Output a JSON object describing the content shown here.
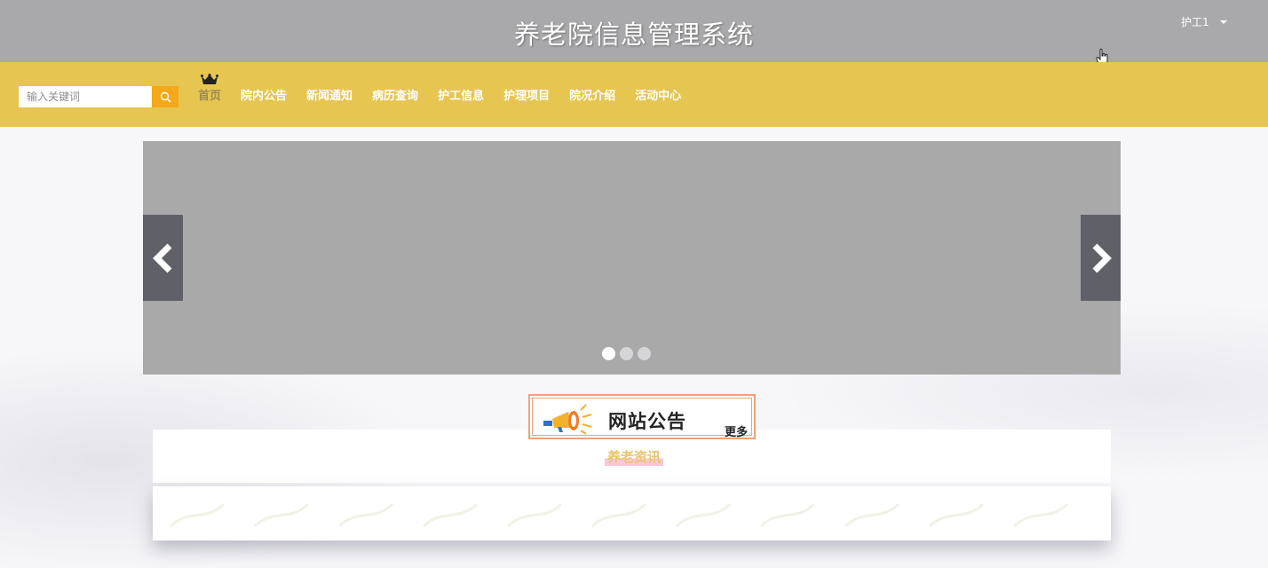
{
  "header": {
    "site_title": "养老院信息管理系统",
    "user_name": "护工1"
  },
  "search": {
    "placeholder": "输入关键词",
    "icon": "search-icon"
  },
  "nav": {
    "items": [
      {
        "label": "首页",
        "active": true
      },
      {
        "label": "院内公告"
      },
      {
        "label": "新闻通知"
      },
      {
        "label": "病历查询"
      },
      {
        "label": "护工信息"
      },
      {
        "label": "护理项目"
      },
      {
        "label": "院况介绍"
      },
      {
        "label": "活动中心"
      }
    ]
  },
  "banner": {
    "dots": 3,
    "active_dot": 1,
    "prev_icon": "chevron-left-icon",
    "next_icon": "chevron-right-icon"
  },
  "notice": {
    "title": "网站公告",
    "more_label": "更多",
    "icon": "megaphone-icon"
  },
  "news": {
    "heading": "养老资讯"
  },
  "colors": {
    "topbar": "#a9a9ab",
    "navbar": "#e6c551",
    "search_button": "#f4a81a",
    "banner": "#a9a9a9",
    "arrow": "#5f6068",
    "notice_border": "#f2a07a",
    "news_heading": "#e9c46d"
  }
}
